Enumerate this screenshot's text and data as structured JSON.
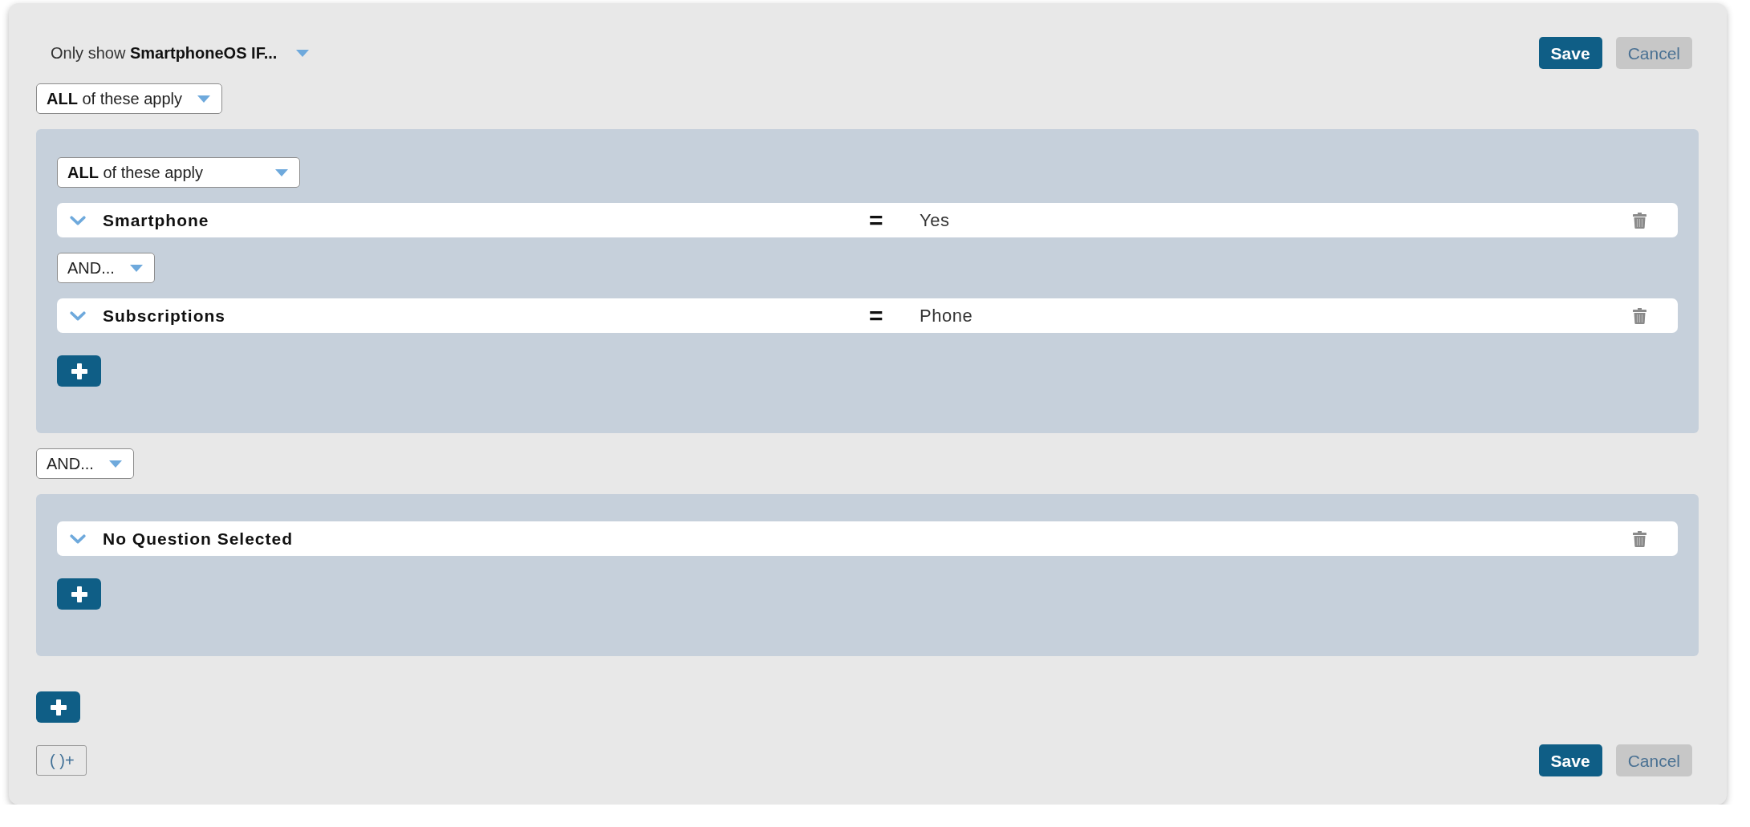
{
  "header": {
    "title": "Only show **SmartphoneOS IF...**",
    "actions": [
      {
        "label": "Save",
        "kind": "save"
      },
      {
        "label": "Cancel",
        "kind": "cancel"
      }
    ]
  },
  "root": {
    "match": "**ALL** of these apply",
    "children": [
      {
        "kind": "group",
        "match": "**ALL** of these apply",
        "children": [
          {
            "kind": "condition",
            "question": "Smartphone",
            "operator": "=",
            "answer": "Yes"
          },
          {
            "kind": "connector",
            "label": "AND..."
          },
          {
            "kind": "condition",
            "question": "Subscriptions",
            "operator": "=",
            "answer": "Phone"
          }
        ]
      },
      {
        "kind": "connector",
        "label": "AND..."
      },
      {
        "kind": "group",
        "children": [
          {
            "kind": "condition",
            "question": "No Question Selected"
          }
        ]
      }
    ]
  },
  "footer": {
    "group_button": "( )+",
    "actions": [
      {
        "label": "Save",
        "kind": "save"
      },
      {
        "label": "Cancel",
        "kind": "cancel"
      }
    ]
  }
}
